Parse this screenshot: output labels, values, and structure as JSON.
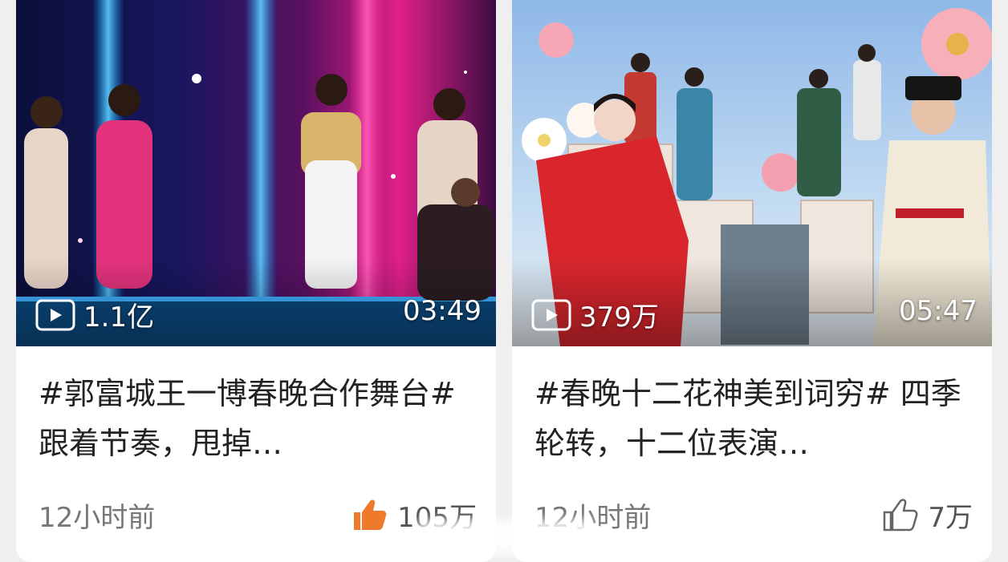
{
  "cards": [
    {
      "play_count": "1.1亿",
      "duration": "03:49",
      "title": "#郭富城王一博春晚合作舞台# 跟着节奏，甩掉…",
      "time": "12小时前",
      "likes": "105万",
      "like_icon_color": "#f07a2b",
      "play_icon": "play-icon",
      "like_icon": "thumbs-up-icon"
    },
    {
      "play_count": "379万",
      "duration": "05:47",
      "title": "#春晚十二花神美到词穷# 四季轮转，十二位表演…",
      "time": "12小时前",
      "likes": "7万",
      "like_icon_color": "#666666",
      "play_icon": "play-icon",
      "like_icon": "thumbs-up-icon"
    }
  ]
}
